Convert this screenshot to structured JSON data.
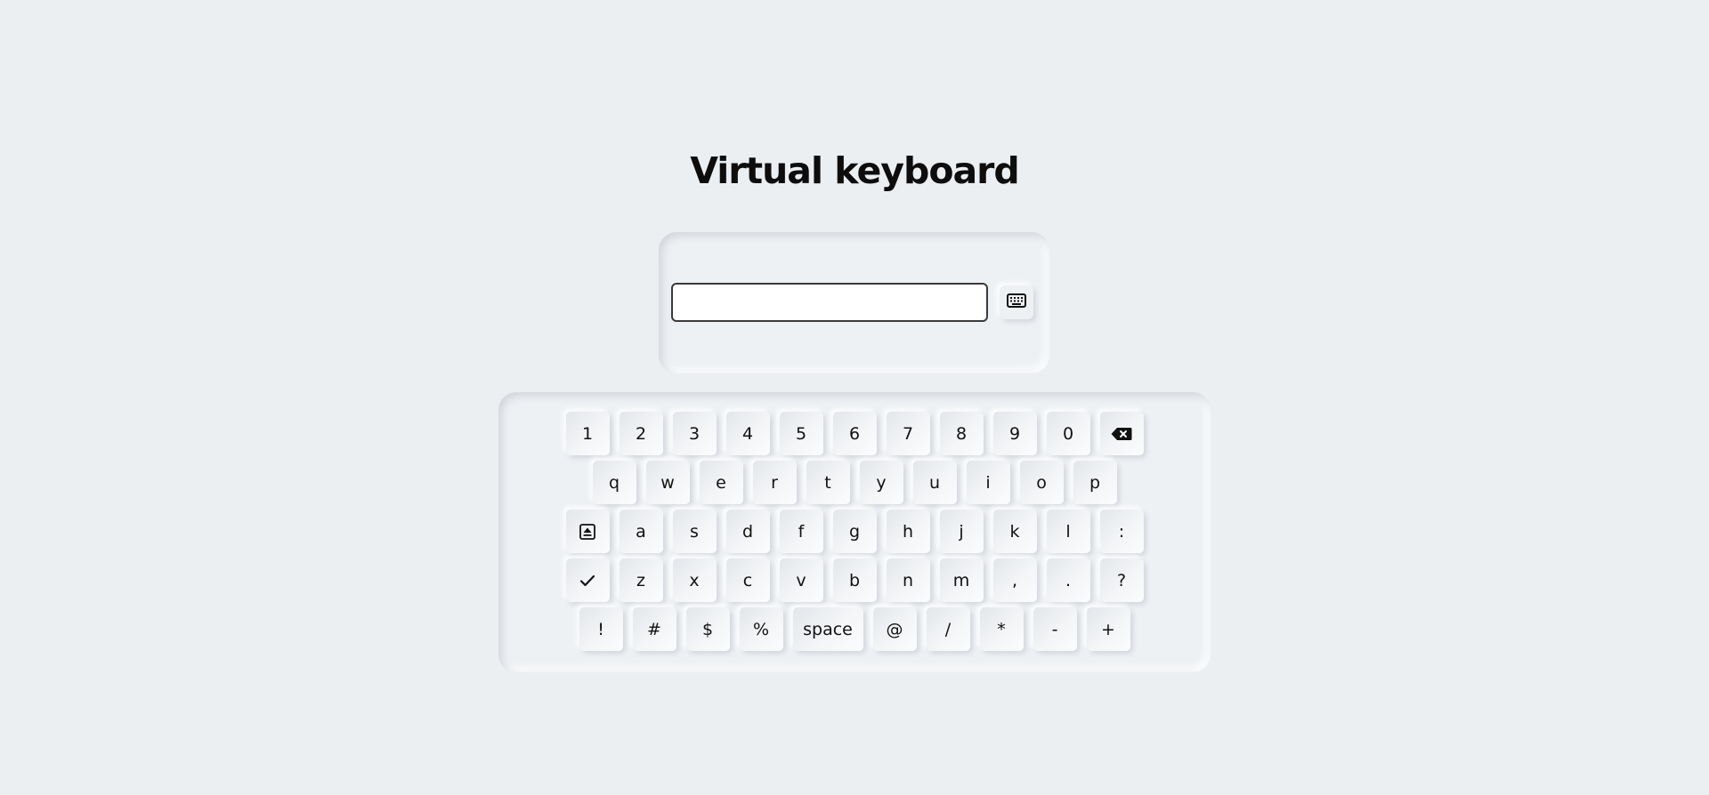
{
  "page": {
    "title": "Virtual keyboard"
  },
  "input": {
    "value": "",
    "placeholder": ""
  },
  "keyboard": {
    "rows": [
      {
        "keys": [
          {
            "label": "1"
          },
          {
            "label": "2"
          },
          {
            "label": "3"
          },
          {
            "label": "4"
          },
          {
            "label": "5"
          },
          {
            "label": "6"
          },
          {
            "label": "7"
          },
          {
            "label": "8"
          },
          {
            "label": "9"
          },
          {
            "label": "0"
          },
          {
            "label": "",
            "icon": "backspace-icon"
          }
        ]
      },
      {
        "keys": [
          {
            "label": "q"
          },
          {
            "label": "w"
          },
          {
            "label": "e"
          },
          {
            "label": "r"
          },
          {
            "label": "t"
          },
          {
            "label": "y"
          },
          {
            "label": "u"
          },
          {
            "label": "i"
          },
          {
            "label": "o"
          },
          {
            "label": "p"
          }
        ]
      },
      {
        "keys": [
          {
            "label": "",
            "icon": "caps-lock-icon"
          },
          {
            "label": "a"
          },
          {
            "label": "s"
          },
          {
            "label": "d"
          },
          {
            "label": "f"
          },
          {
            "label": "g"
          },
          {
            "label": "h"
          },
          {
            "label": "j"
          },
          {
            "label": "k"
          },
          {
            "label": "l"
          },
          {
            "label": ":"
          }
        ]
      },
      {
        "keys": [
          {
            "label": "",
            "icon": "checkmark-icon"
          },
          {
            "label": "z"
          },
          {
            "label": "x"
          },
          {
            "label": "c"
          },
          {
            "label": "v"
          },
          {
            "label": "b"
          },
          {
            "label": "n"
          },
          {
            "label": "m"
          },
          {
            "label": ","
          },
          {
            "label": "."
          },
          {
            "label": "?"
          }
        ]
      },
      {
        "keys": [
          {
            "label": "!"
          },
          {
            "label": "#"
          },
          {
            "label": "$"
          },
          {
            "label": "%"
          },
          {
            "label": "space",
            "wide": true
          },
          {
            "label": "@"
          },
          {
            "label": "/"
          },
          {
            "label": "*"
          },
          {
            "label": "-"
          },
          {
            "label": "+"
          }
        ]
      }
    ]
  },
  "icons": {
    "toggle": "keyboard-icon"
  },
  "colors": {
    "background": "#eceff2",
    "text": "#0d0d0d"
  }
}
